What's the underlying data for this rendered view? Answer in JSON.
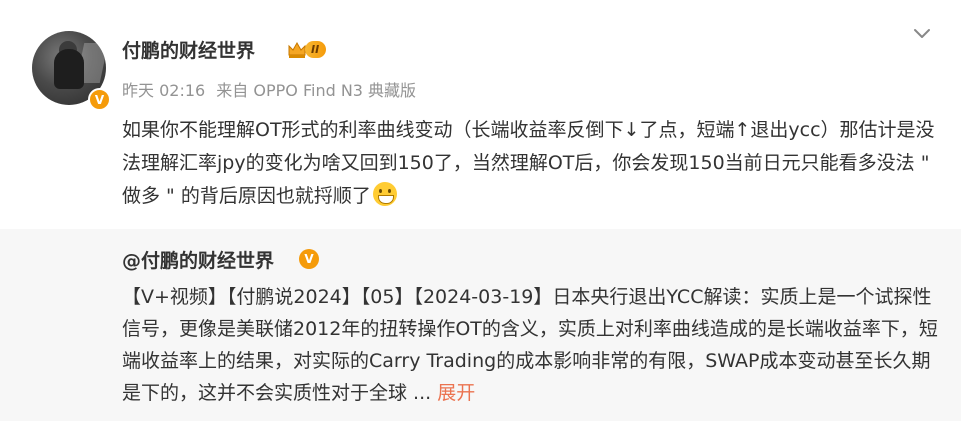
{
  "post": {
    "author": "付鹏的财经世界",
    "verified_badge": "V",
    "level_badge": "II",
    "time": "昨天 02:16",
    "source": "来自 OPPO Find N3 典藏版",
    "text": "如果你不能理解OT形式的利率曲线变动（长端收益率反倒下↓了点，短端↑退出ycc）那估计是没法理解汇率jpy的变化为啥又回到150了，当然理解OT后，你会发现150当前日元只能看多没法 \" 做多 \" 的背后原因也就捋顺了"
  },
  "repost": {
    "author": "@付鹏的财经世界",
    "verified_badge": "V",
    "text": "【V+视频】【付鹏说2024】【05】【2024-03-19】日本央行退出YCC解读：实质上是一个试探性信号，更像是美联储2012年的扭转操作OT的含义，实质上对利率曲线造成的是长端收益率下，短端收益率上的结果，对实际的Carry Trading的成本影响非常的有限，SWAP成本变动甚至长久期是下的，这并不会实质性对于全球 ...",
    "expand_label": "展开"
  },
  "colors": {
    "orange_badge": "#f59b0a",
    "expand_link": "#eb7350",
    "meta_gray": "#939393"
  }
}
